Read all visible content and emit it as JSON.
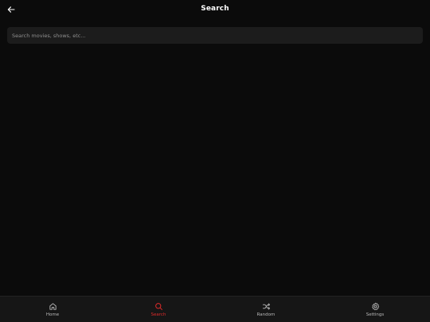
{
  "header": {
    "title": "Search",
    "back_icon": "arrow-left-icon"
  },
  "search": {
    "placeholder": "Search movies, shows, etc...",
    "value": ""
  },
  "tabbar": {
    "tabs": [
      {
        "label": "Home",
        "icon": "home-icon",
        "active": false
      },
      {
        "label": "Search",
        "icon": "search-icon",
        "active": true
      },
      {
        "label": "Random",
        "icon": "shuffle-icon",
        "active": false
      },
      {
        "label": "Settings",
        "icon": "gear-icon",
        "active": false
      }
    ]
  },
  "colors": {
    "background": "#0b0b0b",
    "search_field": "#1c1c1c",
    "tabbar": "#161616",
    "accent": "#e02b2b",
    "inactive": "#b9b9b9"
  }
}
